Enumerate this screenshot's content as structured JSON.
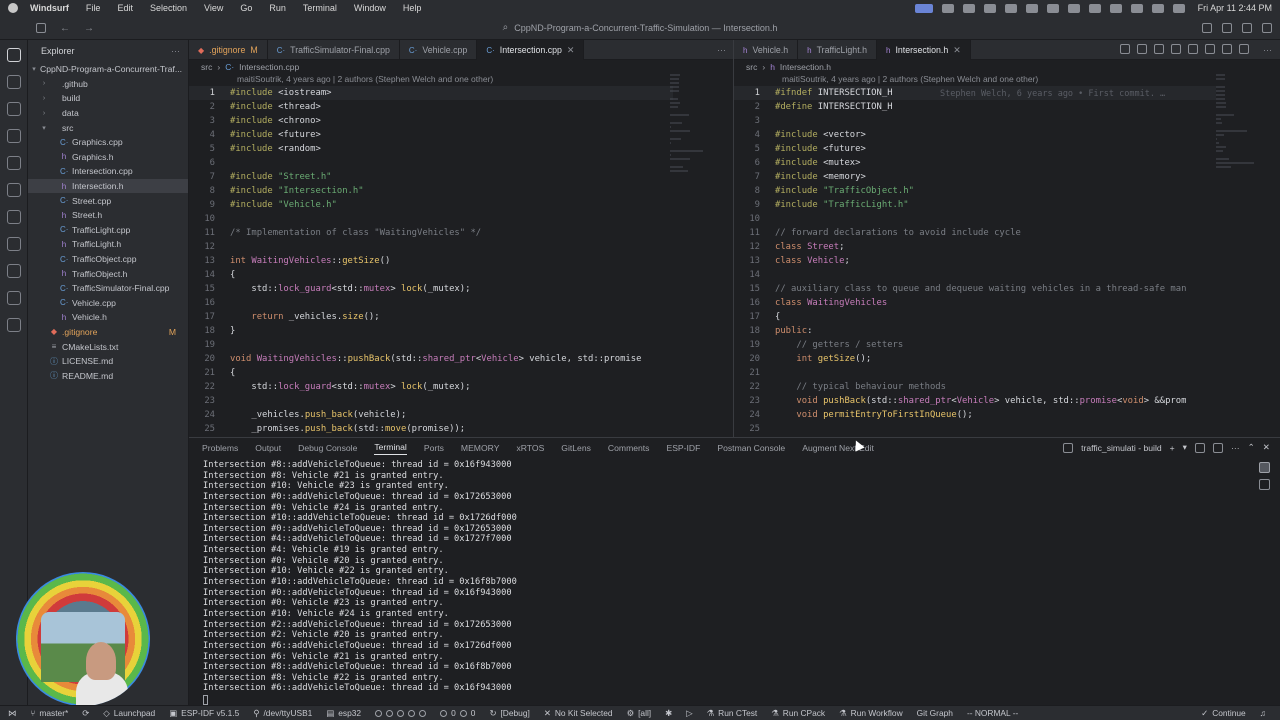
{
  "menubar": {
    "app": "Windsurf",
    "items": [
      "File",
      "Edit",
      "Selection",
      "View",
      "Go",
      "Run",
      "Terminal",
      "Window",
      "Help"
    ],
    "clock": "Fri Apr 11 2:44 PM"
  },
  "titlebar": {
    "title": "CppND-Program-a-Concurrent-Traffic-Simulation — Intersection.h"
  },
  "explorer": {
    "header": "Explorer",
    "root": "CppND-Program-a-Concurrent-Traf...",
    "items": [
      {
        "label": ".github",
        "type": "dir",
        "depth": 1
      },
      {
        "label": "build",
        "type": "dir",
        "depth": 1
      },
      {
        "label": "data",
        "type": "dir",
        "depth": 1
      },
      {
        "label": "src",
        "type": "dir-open",
        "depth": 1
      },
      {
        "label": "Graphics.cpp",
        "type": "cpp",
        "depth": 2
      },
      {
        "label": "Graphics.h",
        "type": "h",
        "depth": 2
      },
      {
        "label": "Intersection.cpp",
        "type": "cpp",
        "depth": 2
      },
      {
        "label": "Intersection.h",
        "type": "h",
        "depth": 2,
        "selected": true
      },
      {
        "label": "Street.cpp",
        "type": "cpp",
        "depth": 2
      },
      {
        "label": "Street.h",
        "type": "h",
        "depth": 2
      },
      {
        "label": "TrafficLight.cpp",
        "type": "cpp",
        "depth": 2
      },
      {
        "label": "TrafficLight.h",
        "type": "h",
        "depth": 2
      },
      {
        "label": "TrafficObject.cpp",
        "type": "cpp",
        "depth": 2
      },
      {
        "label": "TrafficObject.h",
        "type": "h",
        "depth": 2
      },
      {
        "label": "TrafficSimulator-Final.cpp",
        "type": "cpp",
        "depth": 2
      },
      {
        "label": "Vehicle.cpp",
        "type": "cpp",
        "depth": 2
      },
      {
        "label": "Vehicle.h",
        "type": "h",
        "depth": 2
      },
      {
        "label": ".gitignore",
        "type": "git",
        "depth": 1,
        "badge": "M"
      },
      {
        "label": "CMakeLists.txt",
        "type": "txt",
        "depth": 1
      },
      {
        "label": "LICENSE.md",
        "type": "md",
        "depth": 1
      },
      {
        "label": "README.md",
        "type": "md",
        "depth": 1
      }
    ]
  },
  "left_editor": {
    "tabs": [
      {
        "label": ".gitignore",
        "mod": "M",
        "icon": "git"
      },
      {
        "label": "TrafficSimulator-Final.cpp",
        "icon": "cpp"
      },
      {
        "label": "Vehicle.cpp",
        "icon": "cpp"
      },
      {
        "label": "Intersection.cpp",
        "icon": "cpp",
        "active": true
      }
    ],
    "breadcrumb": [
      "src",
      "Intersection.cpp"
    ],
    "blame": "maitiSoutrik, 4 years ago | 2 authors (Stephen Welch and one other)",
    "lines": [
      "<span class=\"pp\">#include</span> <span class=\"inc\">&lt;iostream&gt;</span>",
      "<span class=\"pp\">#include</span> <span class=\"inc\">&lt;thread&gt;</span>",
      "<span class=\"pp\">#include</span> <span class=\"inc\">&lt;chrono&gt;</span>",
      "<span class=\"pp\">#include</span> <span class=\"inc\">&lt;future&gt;</span>",
      "<span class=\"pp\">#include</span> <span class=\"inc\">&lt;random&gt;</span>",
      "",
      "<span class=\"pp\">#include</span> <span class=\"str\">\"Street.h\"</span>",
      "<span class=\"pp\">#include</span> <span class=\"str\">\"Intersection.h\"</span>",
      "<span class=\"pp\">#include</span> <span class=\"str\">\"Vehicle.h\"</span>",
      "",
      "<span class=\"cm\">/* Implementation of class \"WaitingVehicles\" */</span>",
      "",
      "<span class=\"kw\">int</span> <span class=\"ty\">WaitingVehicles</span>::<span class=\"fn\">getSize</span>()",
      "{",
      "    std::<span class=\"ty\">lock_guard</span>&lt;std::<span class=\"ty\">mutex</span>&gt; <span class=\"fn\">lock</span>(_mutex);",
      "",
      "    <span class=\"kw\">return</span> _vehicles.<span class=\"fn\">size</span>();",
      "}",
      "",
      "<span class=\"kw\">void</span> <span class=\"ty\">WaitingVehicles</span>::<span class=\"fn\">pushBack</span>(std::<span class=\"ty\">shared_ptr</span>&lt;<span class=\"ty\">Vehicle</span>&gt; vehicle, std::promise",
      "{",
      "    std::<span class=\"ty\">lock_guard</span>&lt;std::<span class=\"ty\">mutex</span>&gt; <span class=\"fn\">lock</span>(_mutex);",
      "",
      "    _vehicles.<span class=\"fn\">push_back</span>(vehicle);",
      "    _promises.<span class=\"fn\">push_back</span>(std::<span class=\"fn\">move</span>(promise));"
    ]
  },
  "right_editor": {
    "tabs": [
      {
        "label": "Vehicle.h",
        "icon": "h"
      },
      {
        "label": "TrafficLight.h",
        "icon": "h"
      },
      {
        "label": "Intersection.h",
        "icon": "h",
        "active": true
      }
    ],
    "breadcrumb": [
      "src",
      "Intersection.h"
    ],
    "blame": "maitiSoutrik, 4 years ago | 2 authors (Stephen Welch and one other)",
    "ghost": "Stephen Welch, 6 years ago • First commit. …",
    "lines": [
      "<span class=\"pp\">#ifndef</span> INTERSECTION_H",
      "<span class=\"pp\">#define</span> INTERSECTION_H",
      "",
      "<span class=\"pp\">#include</span> <span class=\"inc\">&lt;vector&gt;</span>",
      "<span class=\"pp\">#include</span> <span class=\"inc\">&lt;future&gt;</span>",
      "<span class=\"pp\">#include</span> <span class=\"inc\">&lt;mutex&gt;</span>",
      "<span class=\"pp\">#include</span> <span class=\"inc\">&lt;memory&gt;</span>",
      "<span class=\"pp\">#include</span> <span class=\"str\">\"TrafficObject.h\"</span>",
      "<span class=\"pp\">#include</span> <span class=\"str\">\"TrafficLight.h\"</span>",
      "",
      "<span class=\"cm\">// forward declarations to avoid include cycle</span>",
      "<span class=\"kw\">class</span> <span class=\"ty\">Street</span>;",
      "<span class=\"kw\">class</span> <span class=\"ty\">Vehicle</span>;",
      "",
      "<span class=\"cm\">// auxiliary class to queue and dequeue waiting vehicles in a thread-safe man</span>",
      "<span class=\"kw\">class</span> <span class=\"ty\">WaitingVehicles</span>",
      "{",
      "<span class=\"kw\">public</span>:",
      "    <span class=\"cm\">// getters / setters</span>",
      "    <span class=\"kw\">int</span> <span class=\"fn\">getSize</span>();",
      "",
      "    <span class=\"cm\">// typical behaviour methods</span>",
      "    <span class=\"kw\">void</span> <span class=\"fn\">pushBack</span>(std::<span class=\"ty\">shared_ptr</span>&lt;<span class=\"ty\">Vehicle</span>&gt; vehicle, std::<span class=\"ty\">promise</span>&lt;<span class=\"kw\">void</span>&gt; &amp;&amp;prom",
      "    <span class=\"kw\">void</span> <span class=\"fn\">permitEntryToFirstInQueue</span>();",
      ""
    ]
  },
  "panel": {
    "tabs": [
      "Problems",
      "Output",
      "Debug Console",
      "Terminal",
      "Ports",
      "MEMORY",
      "xRTOS",
      "GitLens",
      "Comments",
      "ESP-IDF",
      "Postman Console",
      "Augment Next Edit"
    ],
    "active_tab": "Terminal",
    "terminal_name": "traffic_simulati - build",
    "lines": [
      "Intersection #8::addVehicleToQueue: thread id = 0x16f943000",
      "Intersection #8: Vehicle #21 is granted entry.",
      "Intersection #10: Vehicle #23 is granted entry.",
      "Intersection #0::addVehicleToQueue: thread id = 0x172653000",
      "Intersection #0: Vehicle #24 is granted entry.",
      "Intersection #10::addVehicleToQueue: thread id = 0x1726df000",
      "Intersection #0::addVehicleToQueue: thread id = 0x172653000",
      "Intersection #4::addVehicleToQueue: thread id = 0x1727f7000",
      "Intersection #4: Vehicle #19 is granted entry.",
      "Intersection #0: Vehicle #20 is granted entry.",
      "Intersection #10: Vehicle #22 is granted entry.",
      "Intersection #10::addVehicleToQueue: thread id = 0x16f8b7000",
      "Intersection #0::addVehicleToQueue: thread id = 0x16f943000",
      "Intersection #0: Vehicle #23 is granted entry.",
      "Intersection #10: Vehicle #24 is granted entry.",
      "Intersection #2::addVehicleToQueue: thread id = 0x172653000",
      "Intersection #2: Vehicle #20 is granted entry.",
      "Intersection #6::addVehicleToQueue: thread id = 0x1726df000",
      "Intersection #6: Vehicle #21 is granted entry.",
      "Intersection #8::addVehicleToQueue: thread id = 0x16f8b7000",
      "Intersection #8: Vehicle #22 is granted entry.",
      "Intersection #6::addVehicleToQueue: thread id = 0x16f943000"
    ]
  },
  "statusbar": {
    "branch": "master*",
    "launchpad": "Launchpad",
    "esp_idf": "ESP-IDF v5.1.5",
    "port": "/dev/ttyUSB1",
    "target": "esp32",
    "problems": "0",
    "warnings": "0",
    "debug": "[Debug]",
    "kit": "No Kit Selected",
    "all": "[all]",
    "ctest": "Run CTest",
    "cpack": "Run CPack",
    "workflow": "Run Workflow",
    "git_graph": "Git Graph",
    "vim": "-- NORMAL --",
    "continue": "Continue"
  }
}
